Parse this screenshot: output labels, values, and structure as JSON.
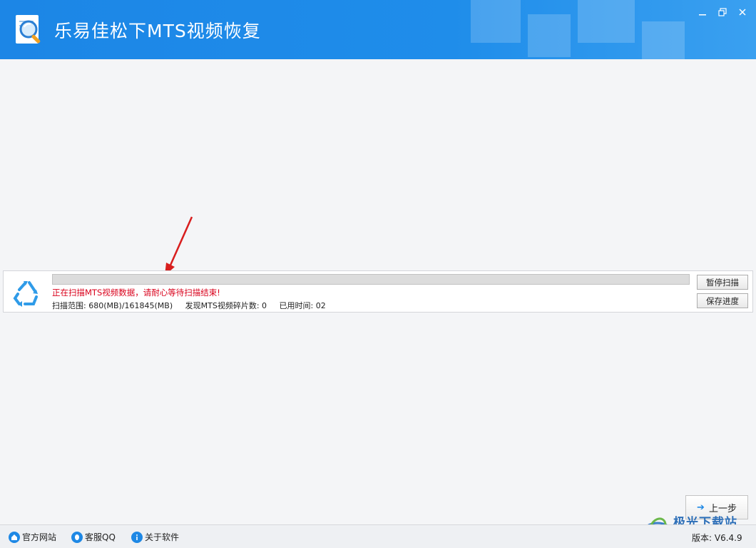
{
  "window": {
    "title": "乐易佳松下MTS视频恢复",
    "accent": "#1f8dea"
  },
  "scan": {
    "progress_fraction": 0.0,
    "message": "正在扫描MTS视频数据，请耐心等待扫描结束!",
    "range_text": "扫描范围: 680(MB)/161845(MB)",
    "found_text": "发现MTS视频碎片数: 0",
    "elapsed_text": "已用时间: 02",
    "pause_label": "暂停扫描",
    "save_label": "保存进度",
    "message_color": "#d9001b"
  },
  "nav": {
    "back_label": "上一步"
  },
  "footer": {
    "site_label": "官方网站",
    "qq_label": "客服QQ",
    "about_label": "关于软件",
    "version": "版本: V6.4.9"
  },
  "watermark": {
    "text": "极光下载站"
  },
  "icons": {
    "app": "magnifier-document-icon",
    "scan": "recycle-arrows-icon",
    "minimize": "minimize-icon",
    "maximize": "maximize-icon",
    "close": "close-icon",
    "back": "arrow-left-icon",
    "site": "home-icon",
    "qq": "qq-penguin-icon",
    "about": "info-icon"
  }
}
